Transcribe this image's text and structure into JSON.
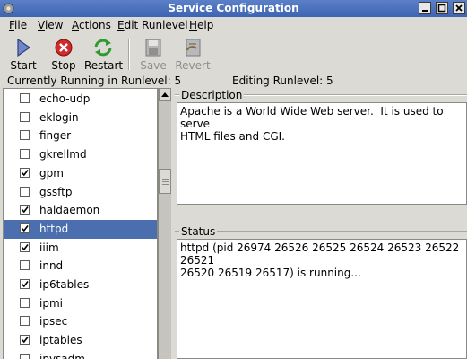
{
  "window": {
    "title": "Service Configuration"
  },
  "menubar": {
    "items": [
      {
        "label": "File"
      },
      {
        "label": "View"
      },
      {
        "label": "Actions"
      },
      {
        "label": "Edit Runlevel"
      },
      {
        "label": "Help"
      }
    ]
  },
  "toolbar": {
    "start_label": "Start",
    "stop_label": "Stop",
    "restart_label": "Restart",
    "save_label": "Save",
    "revert_label": "Revert"
  },
  "status": {
    "current_runlevel_text": "Currently Running in Runlevel: 5",
    "editing_runlevel_text": "Editing Runlevel: 5"
  },
  "services": [
    {
      "name": "echo-udp",
      "checked": false,
      "selected": false
    },
    {
      "name": "eklogin",
      "checked": false,
      "selected": false
    },
    {
      "name": "finger",
      "checked": false,
      "selected": false
    },
    {
      "name": "gkrellmd",
      "checked": false,
      "selected": false
    },
    {
      "name": "gpm",
      "checked": true,
      "selected": false
    },
    {
      "name": "gssftp",
      "checked": false,
      "selected": false
    },
    {
      "name": "haldaemon",
      "checked": true,
      "selected": false
    },
    {
      "name": "httpd",
      "checked": true,
      "selected": true
    },
    {
      "name": "iiim",
      "checked": true,
      "selected": false
    },
    {
      "name": "innd",
      "checked": false,
      "selected": false
    },
    {
      "name": "ip6tables",
      "checked": true,
      "selected": false
    },
    {
      "name": "ipmi",
      "checked": false,
      "selected": false
    },
    {
      "name": "ipsec",
      "checked": false,
      "selected": false
    },
    {
      "name": "iptables",
      "checked": true,
      "selected": false
    },
    {
      "name": "ipvsadm",
      "checked": false,
      "selected": false
    }
  ],
  "description": {
    "label": "Description",
    "text": "Apache is a World Wide Web server.  It is used to serve\nHTML files and CGI."
  },
  "status_pane": {
    "label": "Status",
    "text": "httpd (pid 26974 26526 26525 26524 26523 26522 26521\n26520 26519 26517) is running..."
  },
  "colors": {
    "titlebar": "#4a6fb8",
    "selection": "#4b6eaf",
    "window_bg": "#dcdad5"
  },
  "icons": {
    "start": "play-triangle-icon",
    "stop": "stop-circle-icon",
    "restart": "restart-arrows-icon",
    "save": "floppy-disk-icon",
    "revert": "revert-icon"
  }
}
